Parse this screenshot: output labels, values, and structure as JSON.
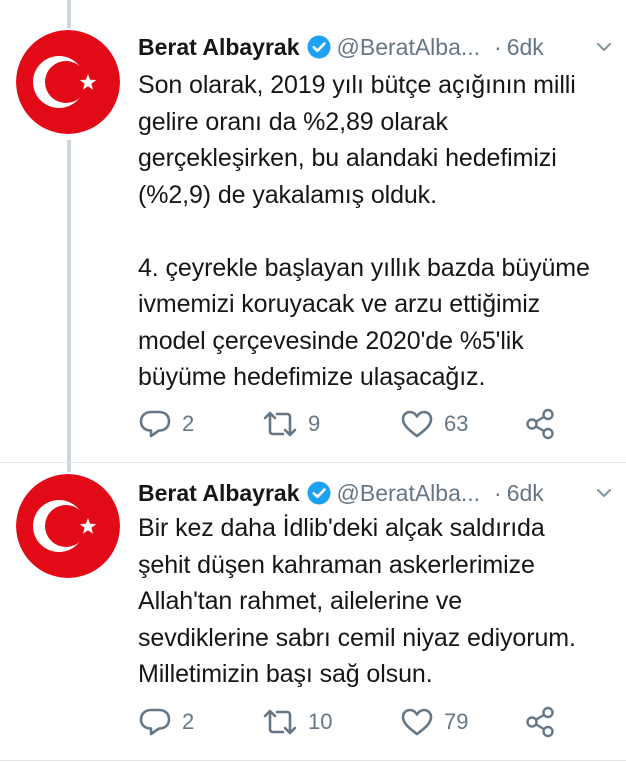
{
  "colors": {
    "flag_red": "#e30a17",
    "verified_blue": "#1da1f2",
    "secondary_text": "#657786",
    "primary_text": "#14171a"
  },
  "tweets": [
    {
      "author_name": "Berat Albayrak",
      "handle": "@BeratAlba...",
      "separator": "·",
      "time": "6dk",
      "text": "Son olarak, 2019 yılı bütçe açığının milli\ngelire oranı da %2,89 olarak\ngerçekleşirken, bu alandaki hedefimizi\n(%2,9) de yakalamış olduk.\n\n4. çeyrekle başlayan yıllık bazda büyüme\nivmemizi koruyacak ve arzu ettiğimiz\nmodel çerçevesinde 2020'de %5'lik\nbüyüme hedefimize ulaşacağız.",
      "replies": "2",
      "retweets": "9",
      "likes": "63"
    },
    {
      "author_name": "Berat Albayrak",
      "handle": "@BeratAlba...",
      "separator": "·",
      "time": "6dk",
      "text": "Bir kez daha İdlib'deki alçak saldırıda\nşehit düşen kahraman askerlerimize\nAllah'tan rahmet, ailelerine ve\nsevdiklerine sabrı cemil niyaz ediyorum.\nMilletimizin başı sağ olsun.",
      "replies": "2",
      "retweets": "10",
      "likes": "79"
    }
  ]
}
